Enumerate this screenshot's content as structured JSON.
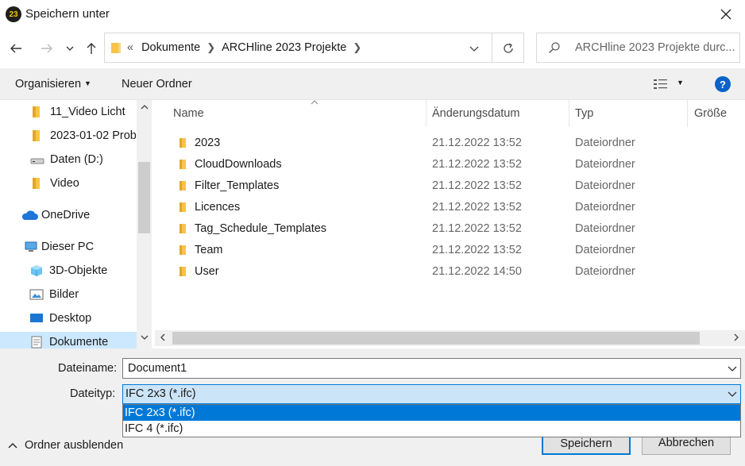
{
  "window": {
    "title": "Speichern unter",
    "app_icon_text": "23"
  },
  "address": {
    "overflow": "«",
    "crumbs": [
      "Dokumente",
      "ARCHline 2023 Projekte"
    ],
    "search_placeholder": "ARCHline 2023 Projekte durc..."
  },
  "toolbar": {
    "organize": "Organisieren",
    "new_folder": "Neuer Ordner"
  },
  "sidebar": {
    "items": [
      {
        "label": "11_Video Licht",
        "icon": "folder-icon"
      },
      {
        "label": "2023-01-02 Prob",
        "icon": "folder-icon"
      },
      {
        "label": "Daten (D:)",
        "icon": "drive-icon"
      },
      {
        "label": "Video",
        "icon": "folder-icon"
      },
      {
        "label": "OneDrive",
        "icon": "onedrive-icon"
      },
      {
        "label": "Dieser PC",
        "icon": "pc-icon"
      },
      {
        "label": "3D-Objekte",
        "icon": "cube-icon"
      },
      {
        "label": "Bilder",
        "icon": "pictures-icon"
      },
      {
        "label": "Desktop",
        "icon": "desktop-icon"
      },
      {
        "label": "Dokumente",
        "icon": "documents-icon"
      }
    ]
  },
  "columns": {
    "name": "Name",
    "date": "Änderungsdatum",
    "type": "Typ",
    "size": "Größe"
  },
  "files": [
    {
      "name": "2023",
      "date": "21.12.2022 13:52",
      "type": "Dateiordner"
    },
    {
      "name": "CloudDownloads",
      "date": "21.12.2022 13:52",
      "type": "Dateiordner"
    },
    {
      "name": "Filter_Templates",
      "date": "21.12.2022 13:52",
      "type": "Dateiordner"
    },
    {
      "name": "Licences",
      "date": "21.12.2022 13:52",
      "type": "Dateiordner"
    },
    {
      "name": "Tag_Schedule_Templates",
      "date": "21.12.2022 13:52",
      "type": "Dateiordner"
    },
    {
      "name": "Team",
      "date": "21.12.2022 13:52",
      "type": "Dateiordner"
    },
    {
      "name": "User",
      "date": "21.12.2022 14:50",
      "type": "Dateiordner"
    }
  ],
  "form": {
    "filename_label": "Dateiname:",
    "filename_value": "Document1",
    "filetype_label": "Dateityp:",
    "filetype_value": "IFC 2x3 (*.ifc)",
    "filetype_options": [
      "IFC 2x3 (*.ifc)",
      "IFC 4 (*.ifc)"
    ]
  },
  "buttons": {
    "save": "Speichern",
    "cancel": "Abbrechen",
    "hide_folders": "Ordner ausblenden"
  },
  "colors": {
    "accent": "#0078d7",
    "selection": "#cce8ff",
    "folder": "#f8c34a"
  }
}
